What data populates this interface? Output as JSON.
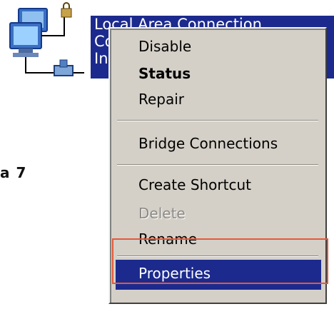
{
  "connection": {
    "line1": "Local Area Connection",
    "line2": "Co",
    "line3": "In"
  },
  "side_text": "a 7",
  "context_menu": {
    "items": [
      {
        "label": "Disable",
        "style": "normal"
      },
      {
        "label": "Status",
        "style": "bold"
      },
      {
        "label": "Repair",
        "style": "normal"
      },
      {
        "label": "Bridge Connections",
        "style": "normal"
      },
      {
        "label": "Create Shortcut",
        "style": "normal"
      },
      {
        "label": "Delete",
        "style": "disabled"
      },
      {
        "label": "Rename",
        "style": "normal"
      },
      {
        "label": "Properties",
        "style": "selected"
      }
    ]
  },
  "colors": {
    "selection": "#1c2a8e",
    "menu_background": "#d4d0c8",
    "highlight_frame": "#e45a3a"
  },
  "icons": {
    "network": "network-connection-icon"
  }
}
